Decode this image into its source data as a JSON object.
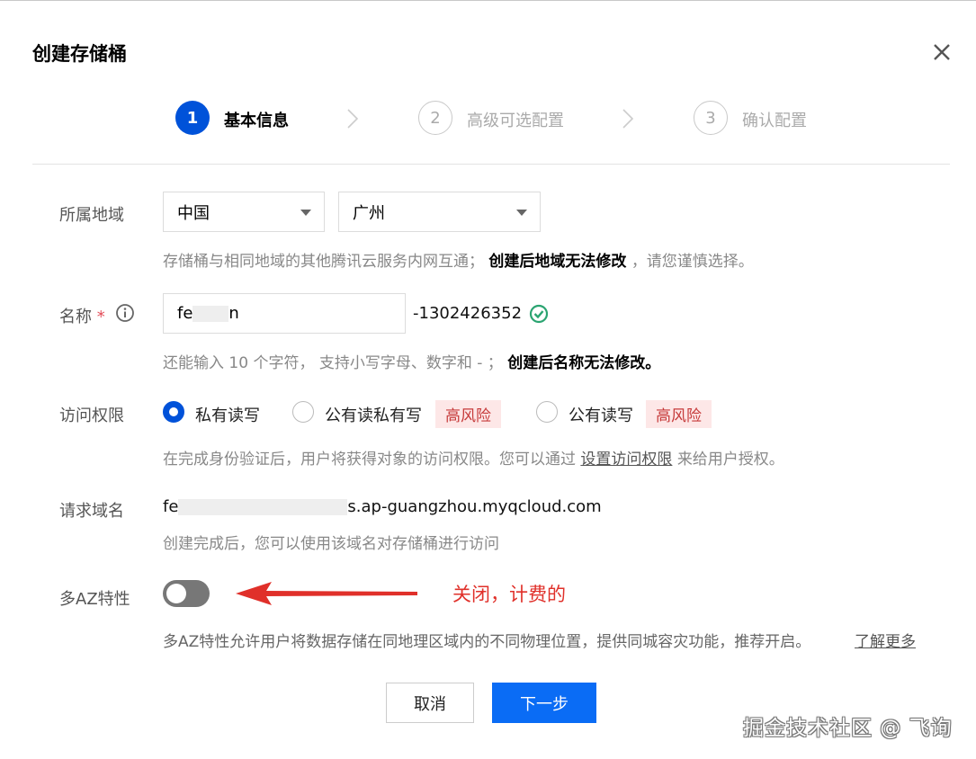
{
  "dialog": {
    "title": "创建存储桶",
    "close_icon": "close-icon"
  },
  "steps": [
    {
      "number": "1",
      "label": "基本信息",
      "state": "active"
    },
    {
      "number": "2",
      "label": "高级可选配置",
      "state": "todo"
    },
    {
      "number": "3",
      "label": "确认配置",
      "state": "todo"
    }
  ],
  "region": {
    "label": "所属地域",
    "country": "中国",
    "city": "广州",
    "hint_prefix": "存储桶与相同地域的其他腾讯云服务内网互通；",
    "hint_bold": "创建后地域无法修改",
    "hint_suffix": "，请您谨慎选择。"
  },
  "name": {
    "label": "名称",
    "required_mark": "*",
    "value_start": "fe",
    "value_end": "n",
    "suffix": "-1302426352",
    "hint_prefix": "还能输入 10 个字符， 支持小写字母、数字和 - ；",
    "hint_bold": "创建后名称无法修改。"
  },
  "access": {
    "label": "访问权限",
    "options": [
      {
        "label": "私有读写",
        "selected": true
      },
      {
        "label": "公有读私有写",
        "selected": false,
        "badge": "高风险"
      },
      {
        "label": "公有读写",
        "selected": false,
        "badge": "高风险"
      }
    ],
    "hint_prefix": "在完成身份验证后，用户将获得对象的访问权限。您可以通过",
    "hint_link": "设置访问权限",
    "hint_suffix": "来给用户授权。"
  },
  "domain": {
    "label": "请求域名",
    "value_start": "fe",
    "value_end": "s.ap-guangzhou.myqcloud.com",
    "hint": "创建完成后，您可以使用该域名对存储桶进行访问"
  },
  "multi_az": {
    "label": "多AZ特性",
    "enabled": false,
    "annotation": "关闭，计费的",
    "hint": "多AZ特性允许用户将数据存储在同地理区域内的不同物理位置，提供同城容灾功能，推荐开启。",
    "learn_more": "了解更多"
  },
  "footer": {
    "cancel_label": "取消",
    "next_label": "下一步"
  },
  "watermark": "掘金技术社区 @ 飞询",
  "colors": {
    "primary": "#0052d9",
    "next_button": "#0a6cf5",
    "risk_bg": "#fde7e7",
    "risk_text": "#c63a3a",
    "annotation": "#e0302a",
    "success": "#2ba471"
  }
}
